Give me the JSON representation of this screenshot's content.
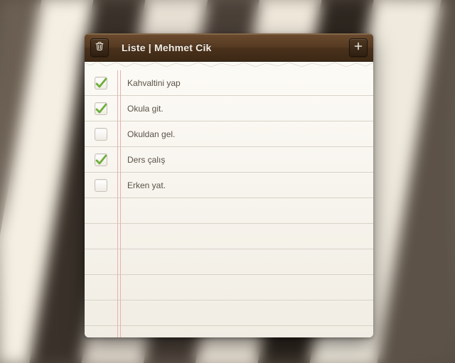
{
  "header": {
    "title": "Liste | Mehmet Cik"
  },
  "items": [
    {
      "label": "Kahvaltini yap",
      "checked": true
    },
    {
      "label": "Okula git.",
      "checked": true
    },
    {
      "label": "Okuldan gel.",
      "checked": false
    },
    {
      "label": "Ders çalış",
      "checked": true
    },
    {
      "label": "Erken yat.",
      "checked": false
    }
  ]
}
